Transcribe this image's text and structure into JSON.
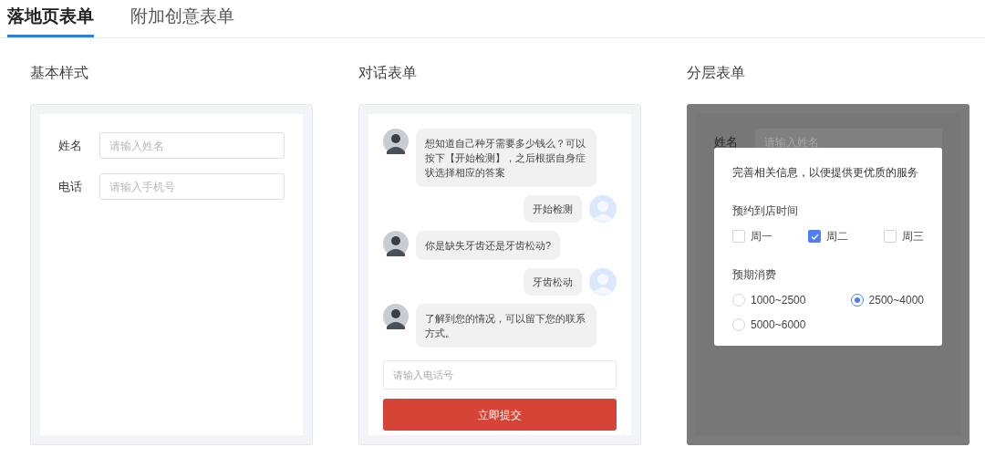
{
  "tabs": [
    {
      "label": "落地页表单",
      "selected": true
    },
    {
      "label": "附加创意表单",
      "selected": false
    }
  ],
  "sections": [
    {
      "kind": "basic",
      "title": "基本样式",
      "fields": [
        {
          "label": "姓名",
          "placeholder": "请输入姓名"
        },
        {
          "label": "电话",
          "placeholder": "请输入手机号"
        }
      ]
    },
    {
      "kind": "chat",
      "title": "对话表单",
      "messages": [
        {
          "kind": "agent",
          "text": "想知道自己种牙需要多少钱么？可以按下【开始检测】，之后根据自身症状选择相应的答案"
        },
        {
          "kind": "user",
          "text": "开始检测"
        },
        {
          "kind": "agent",
          "text": "你是缺失牙齿还是牙齿松动?"
        },
        {
          "kind": "user",
          "text": "牙齿松动"
        },
        {
          "kind": "agent",
          "text": "了解到您的情况，可以留下您的联系方式。"
        }
      ],
      "phone_placeholder": "请输入电话号",
      "submit": "立即提交"
    },
    {
      "kind": "layered",
      "title": "分层表单",
      "background_fields": [
        {
          "label": "姓名",
          "placeholder": "请输入姓名"
        }
      ],
      "dialog": {
        "heading": "完善相关信息，以便提供更优质的服务",
        "groups": [
          {
            "kind": "checkbox",
            "label": "预约到店时间",
            "options": [
              {
                "label": "周一",
                "checked": false
              },
              {
                "label": "周二",
                "checked": true
              },
              {
                "label": "周三",
                "checked": false
              }
            ]
          },
          {
            "kind": "radio",
            "label": "预期消费",
            "options": [
              {
                "label": "1000~2500",
                "selected": false
              },
              {
                "label": "2500~4000",
                "selected": true
              },
              {
                "label": "5000~6000",
                "selected": false
              }
            ]
          }
        ]
      }
    }
  ]
}
